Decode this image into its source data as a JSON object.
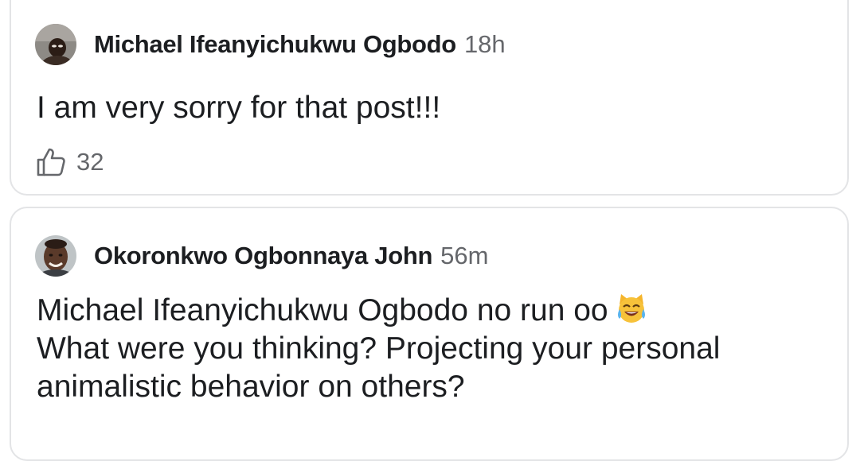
{
  "comments": [
    {
      "author": "Michael Ifeanyichukwu Ogbodo",
      "time": "18h",
      "text": "I am very sorry for that post!!!",
      "likes": "32",
      "avatar_icon": "profile-photo-avatar"
    },
    {
      "author": "Okoronkwo Ogbonnaya John",
      "time": "56m",
      "lines": [
        "Michael Ifeanyichukwu Ogbodo no run oo",
        "What were you thinking? Projecting your personal",
        "animalistic behavior on others?"
      ],
      "emoji_icon": "cat-with-tears-of-joy-emoji",
      "avatar_icon": "profile-photo-avatar"
    }
  ],
  "colors": {
    "text": "#1c1e21",
    "muted": "#65676b",
    "card_border": "#e3e4e6"
  }
}
